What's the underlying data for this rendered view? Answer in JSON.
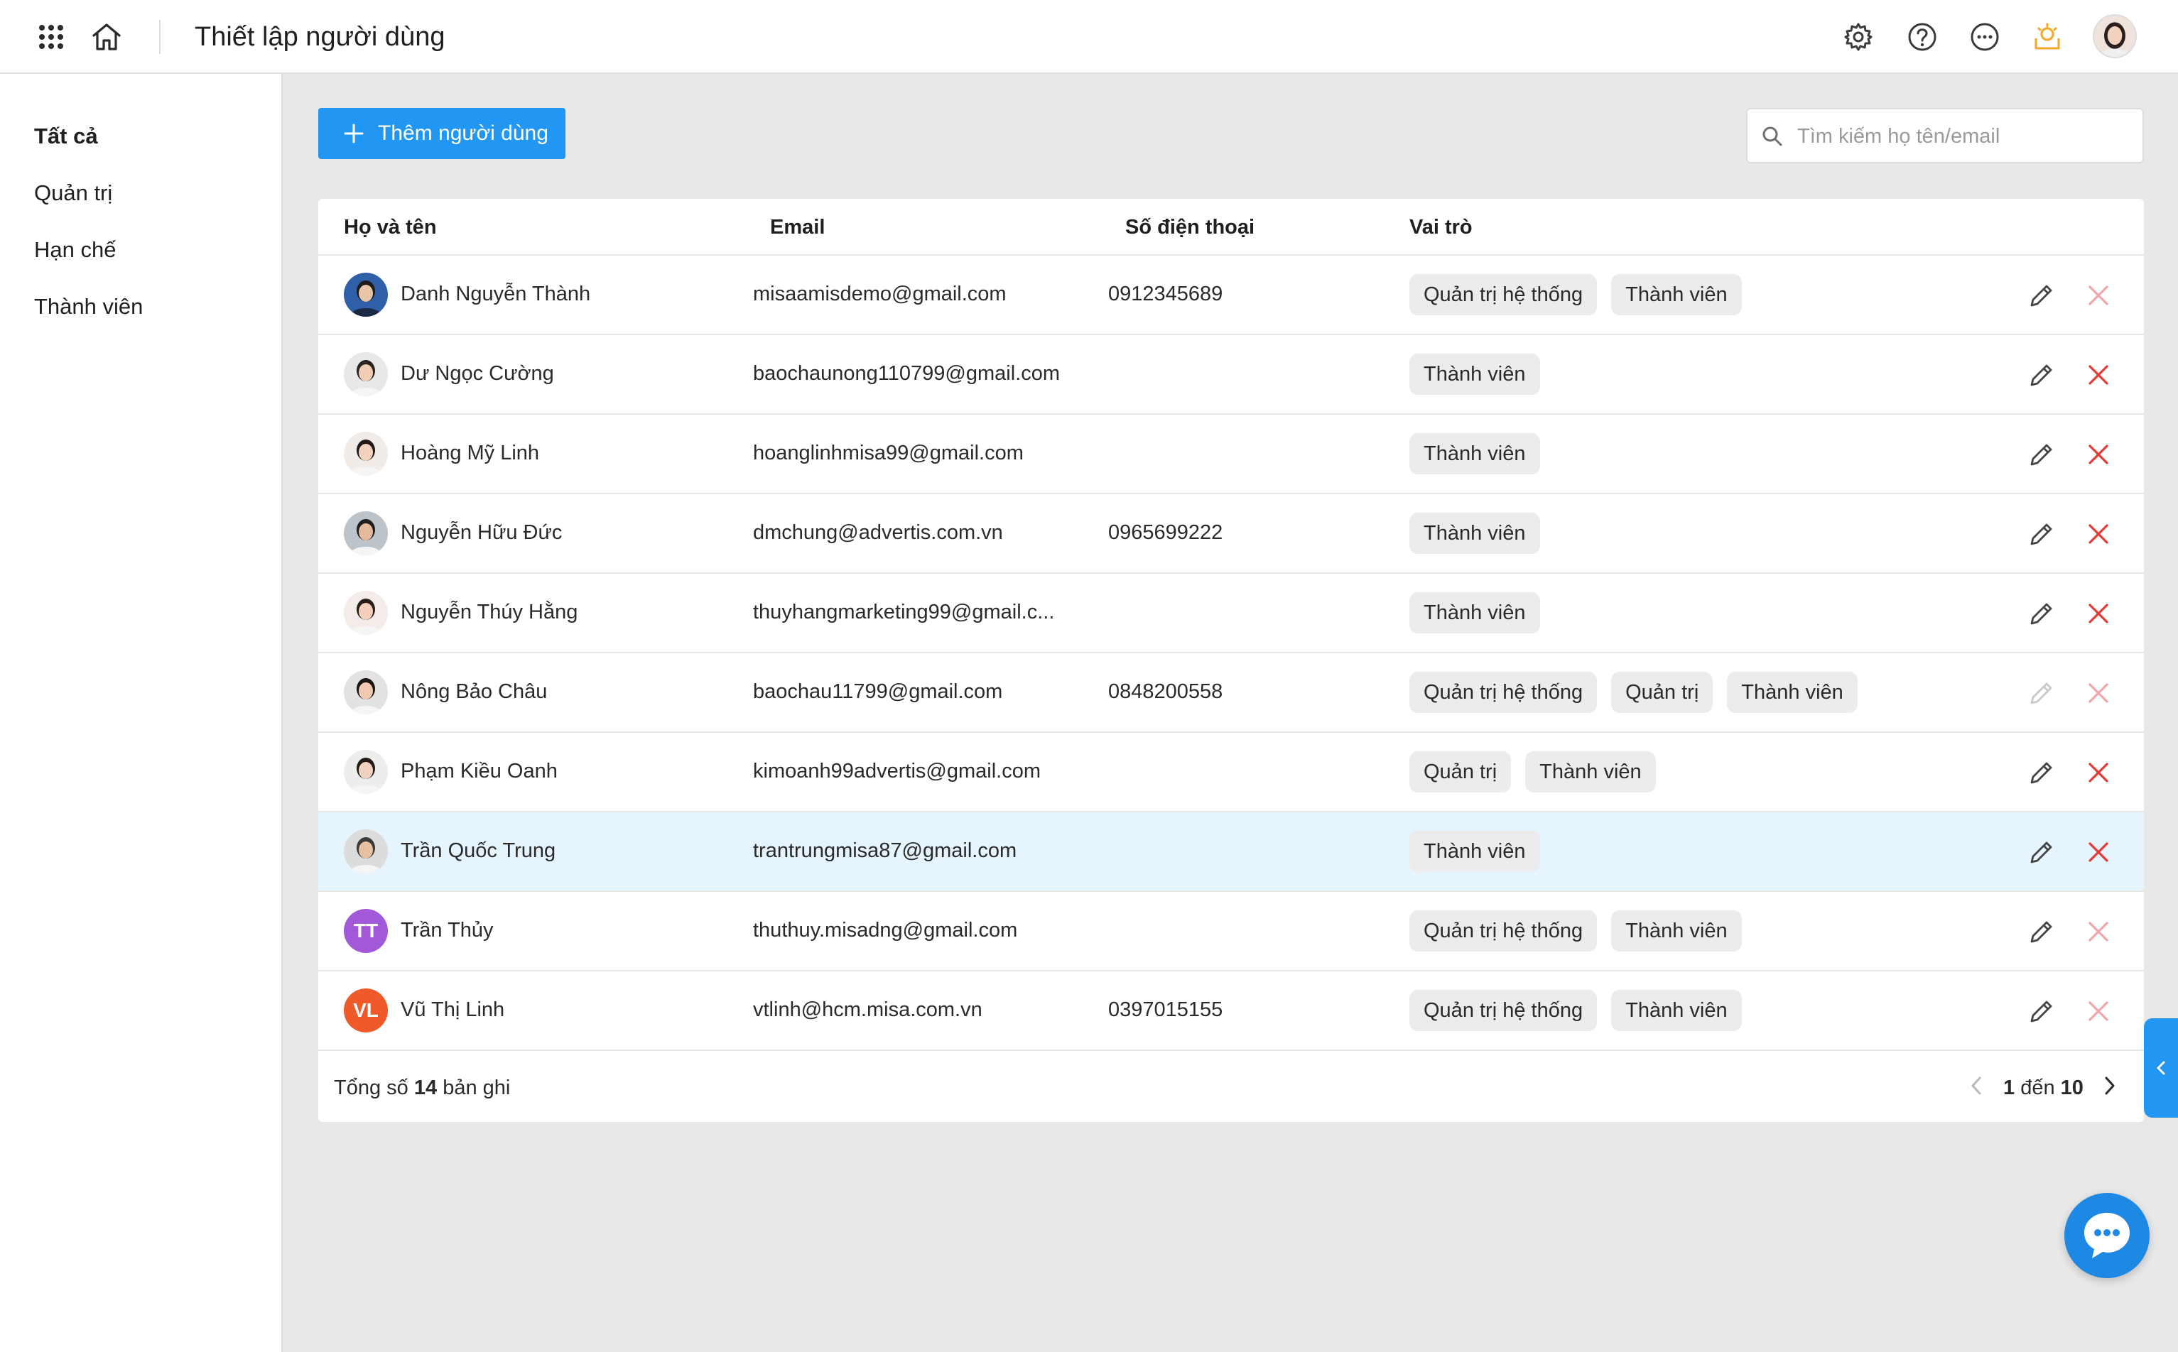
{
  "header": {
    "title": "Thiết lập người dùng",
    "icons": [
      "apps-grid-icon",
      "home-icon",
      "settings-icon",
      "help-icon",
      "more-icon",
      "notification-icon"
    ]
  },
  "sidebar": {
    "items": [
      {
        "label": "Tất cả",
        "active": true
      },
      {
        "label": "Quản trị",
        "active": false
      },
      {
        "label": "Hạn chế",
        "active": false
      },
      {
        "label": "Thành viên",
        "active": false
      }
    ]
  },
  "toolbar": {
    "add_label": "Thêm người dùng",
    "search_placeholder": "Tìm kiếm họ tên/email"
  },
  "table": {
    "columns": {
      "name": "Họ và tên",
      "email": "Email",
      "phone": "Số điện thoại",
      "role": "Vai trò"
    },
    "rows": [
      {
        "name": "Danh Nguyễn Thành",
        "email": "misaamisdemo@gmail.com",
        "phone": "0912345689",
        "roles": [
          "Quản trị hệ thống",
          "Thành viên"
        ],
        "avatar": "photo"
      },
      {
        "name": "Dư Ngọc Cường",
        "email": "baochaunong110799@gmail.com",
        "phone": "",
        "roles": [
          "Thành viên"
        ],
        "avatar": "photo"
      },
      {
        "name": "Hoàng Mỹ Linh",
        "email": "hoanglinhmisa99@gmail.com",
        "phone": "",
        "roles": [
          "Thành viên"
        ],
        "avatar": "photo"
      },
      {
        "name": "Nguyễn Hữu Đức",
        "email": "dmchung@advertis.com.vn",
        "phone": "0965699222",
        "roles": [
          "Thành viên"
        ],
        "avatar": "photo"
      },
      {
        "name": "Nguyễn Thúy Hằng",
        "email": "thuyhangmarketing99@gmail.c...",
        "phone": "",
        "roles": [
          "Thành viên"
        ],
        "avatar": "photo"
      },
      {
        "name": "Nông Bảo Châu",
        "email": "baochau11799@gmail.com",
        "phone": "0848200558",
        "roles": [
          "Quản trị hệ thống",
          "Quản trị",
          "Thành viên"
        ],
        "avatar": "photo"
      },
      {
        "name": "Phạm Kiều Oanh",
        "email": "kimoanh99advertis@gmail.com",
        "phone": "",
        "roles": [
          "Quản trị",
          "Thành viên"
        ],
        "avatar": "photo"
      },
      {
        "name": "Trần Quốc Trung",
        "email": "trantrungmisa87@gmail.com",
        "phone": "",
        "roles": [
          "Thành viên"
        ],
        "avatar": "photo"
      },
      {
        "name": "Trần Thủy",
        "email": "thuthuy.misadng@gmail.com",
        "phone": "",
        "roles": [
          "Quản trị hệ thống",
          "Thành viên"
        ],
        "avatar": "initials",
        "initials": "TT"
      },
      {
        "name": "Vũ Thị Linh",
        "email": "vtlinh@hcm.misa.com.vn",
        "phone": "0397015155",
        "roles": [
          "Quản trị hệ thống",
          "Thành viên"
        ],
        "avatar": "initials",
        "initials": "VL"
      }
    ]
  },
  "footer": {
    "total_prefix": "Tổng số",
    "total_count": "14",
    "total_suffix": "bản ghi",
    "page_from": "1",
    "page_word": "đến",
    "page_to": "10"
  },
  "colors": {
    "accent": "#2196f3",
    "delete_red": "#e53935",
    "delete_disabled": "#f2a6a6",
    "highlight_row": "#e5f4fd",
    "notification": "#f5a623",
    "avatar_tt": "#a259d9",
    "avatar_vl": "#f0592a"
  }
}
